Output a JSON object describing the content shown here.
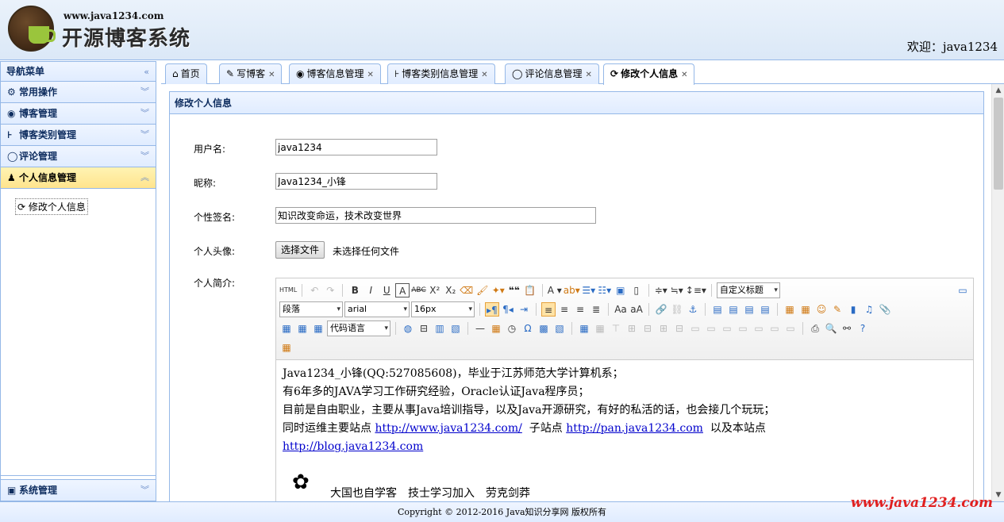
{
  "header": {
    "site_url": "www.java1234.com",
    "site_name": "开源博客系统",
    "welcome": "欢迎：java1234"
  },
  "sidebar": {
    "title": "导航菜单",
    "groups": [
      {
        "label": "常用操作",
        "icon": "gear-icon"
      },
      {
        "label": "博客管理",
        "icon": "blog-icon"
      },
      {
        "label": "博客类别管理",
        "icon": "tree-icon"
      },
      {
        "label": "评论管理",
        "icon": "comment-icon"
      },
      {
        "label": "个人信息管理",
        "icon": "user-icon"
      }
    ],
    "sub_item": "修改个人信息",
    "bottom_group": "系统管理"
  },
  "tabs": [
    {
      "label": "首页",
      "icon": "home-icon"
    },
    {
      "label": "写博客",
      "icon": "edit-icon"
    },
    {
      "label": "博客信息管理",
      "icon": "blog-icon"
    },
    {
      "label": "博客类别信息管理",
      "icon": "tree-icon"
    },
    {
      "label": "评论信息管理",
      "icon": "comment-icon"
    },
    {
      "label": "修改个人信息",
      "icon": "refresh-icon"
    }
  ],
  "panel": {
    "title": "修改个人信息",
    "fields": {
      "username_label": "用户名:",
      "username_value": "java1234",
      "nickname_label": "昵称:",
      "nickname_value": "Java1234_小锋",
      "sign_label": "个性签名:",
      "sign_value": "知识改变命运，技术改变世界",
      "avatar_label": "个人头像:",
      "avatar_button": "选择文件",
      "avatar_status": "未选择任何文件",
      "profile_label": "个人简介:"
    }
  },
  "editor": {
    "custom_title": "自定义标题",
    "paragraph": "段落",
    "font": "arial",
    "size": "16px",
    "code_lang": "代码语言",
    "lines": [
      "Java1234_小锋(QQ:527085608)，毕业于江苏师范大学计算机系；",
      "有6年多的JAVA学习工作研究经验，Oracle认证Java程序员；",
      "目前是自由职业，主要从事Java培训指导，以及Java开源研究，有好的私活的话，也会接几个玩玩；"
    ],
    "line4_prefix": "同时运维主要站点",
    "link1": "http://www.java1234.com/",
    "line4_mid": "子站点",
    "link2": "http://pan.java1234.com",
    "line4_suffix": "以及本站点",
    "link3": "http://blog.java1234.com",
    "partial_line": "大国也自学客　技士学习加入　劳克剑莽"
  },
  "footer": {
    "copyright": "Copyright © 2012-2016 Java知识分享网 版权所有"
  },
  "watermark": "www.java1234.com"
}
